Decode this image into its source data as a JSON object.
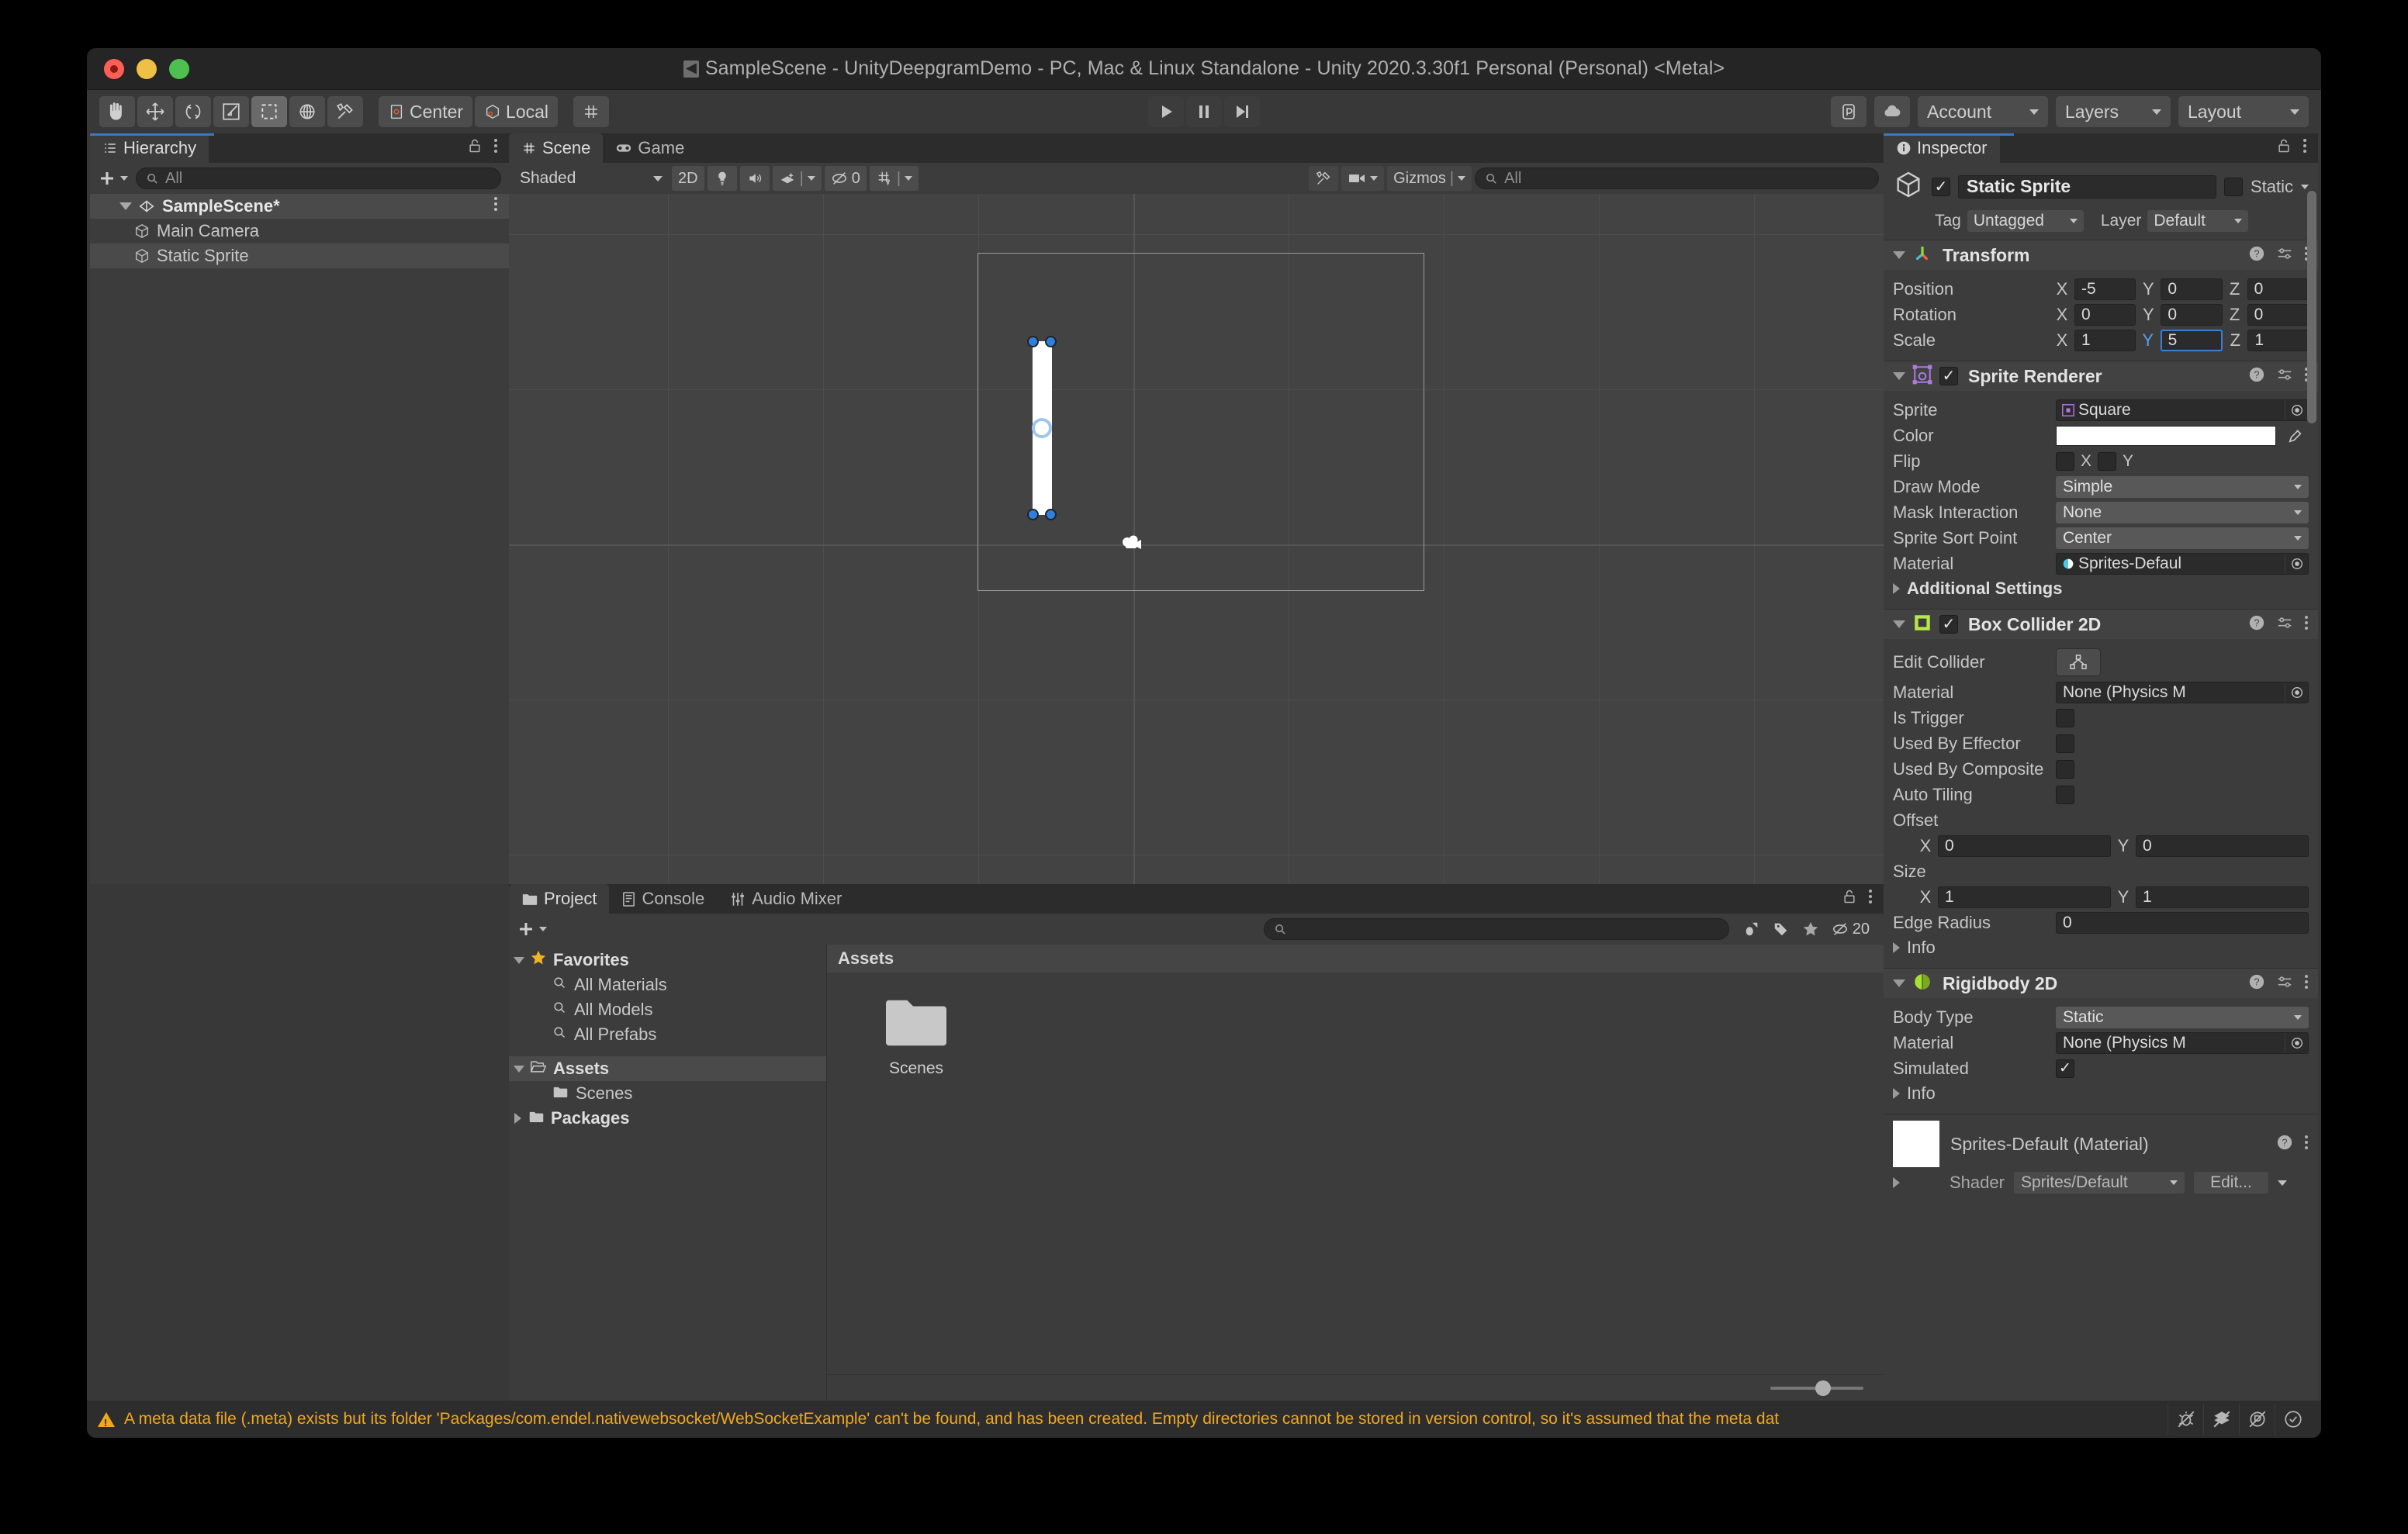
{
  "window": {
    "title": "SampleScene - UnityDeepgramDemo - PC, Mac & Linux Standalone - Unity 2020.3.30f1 Personal (Personal) <Metal>"
  },
  "toolbar": {
    "tools": [
      {
        "name": "hand-tool",
        "icon": "hand",
        "active": false
      },
      {
        "name": "move-tool",
        "icon": "move",
        "active": false
      },
      {
        "name": "rotate-tool",
        "icon": "rotate",
        "active": false
      },
      {
        "name": "scale-tool",
        "icon": "scale",
        "active": false
      },
      {
        "name": "rect-tool",
        "icon": "rect",
        "active": true
      },
      {
        "name": "transform-tool",
        "icon": "transform",
        "active": false
      },
      {
        "name": "custom-tool",
        "icon": "wrench",
        "active": false
      }
    ],
    "pivot_mode": "Center",
    "pivot_rotation": "Local",
    "play": "play",
    "pause": "pause",
    "step": "step",
    "account": "Account",
    "layers": "Layers",
    "layout": "Layout"
  },
  "hierarchy": {
    "tab_label": "Hierarchy",
    "search_placeholder": "All",
    "items": [
      {
        "label": "SampleScene*",
        "depth": 0,
        "type": "scene",
        "selected": true,
        "expanded": true
      },
      {
        "label": "Main Camera",
        "depth": 1,
        "type": "gameobject",
        "selected": false
      },
      {
        "label": "Static Sprite",
        "depth": 1,
        "type": "gameobject",
        "selected": true
      }
    ]
  },
  "scene_view": {
    "tabs": [
      {
        "label": "Scene",
        "active": true,
        "icon": "grid-icon"
      },
      {
        "label": "Game",
        "active": false,
        "icon": "gamepad-icon"
      }
    ],
    "shading_mode": "Shaded",
    "mode_2d": "2D",
    "hidden_count": "0",
    "gizmos_label": "Gizmos",
    "search_placeholder": "All"
  },
  "inspector": {
    "tab_label": "Inspector",
    "object_name": "Static Sprite",
    "enabled": true,
    "static_label": "Static",
    "static_checked": false,
    "tag_label": "Tag",
    "tag_value": "Untagged",
    "layer_label": "Layer",
    "layer_value": "Default",
    "components": [
      {
        "name": "Transform",
        "icon_color": "#f0623c",
        "enabled_toggle": false,
        "rows": [
          {
            "label": "Position",
            "type": "vec3",
            "x": "-5",
            "y": "0",
            "z": "0"
          },
          {
            "label": "Rotation",
            "type": "vec3",
            "x": "0",
            "y": "0",
            "z": "0"
          },
          {
            "label": "Scale",
            "type": "vec3",
            "x": "1",
            "y": "5",
            "z": "1",
            "focus_axis": "Y"
          }
        ]
      },
      {
        "name": "Sprite Renderer",
        "icon_color": "#b07ae0",
        "enabled_toggle": true,
        "rows": [
          {
            "label": "Sprite",
            "type": "object",
            "value": "Square"
          },
          {
            "label": "Color",
            "type": "color",
            "value": "#FFFFFF"
          },
          {
            "label": "Flip",
            "type": "flip",
            "x_label": "X",
            "y_label": "Y",
            "x": false,
            "y": false
          },
          {
            "label": "Draw Mode",
            "type": "enum",
            "value": "Simple"
          },
          {
            "label": "Mask Interaction",
            "type": "enum",
            "value": "None"
          },
          {
            "label": "Sprite Sort Point",
            "type": "enum",
            "value": "Center"
          },
          {
            "label": "Material",
            "type": "object",
            "value": "Sprites-Defaul"
          }
        ],
        "foldout": "Additional Settings"
      },
      {
        "name": "Box Collider 2D",
        "icon_color": "#b6e84a",
        "enabled_toggle": true,
        "rows": [
          {
            "label": "Edit Collider",
            "type": "button"
          },
          {
            "label": "Material",
            "type": "object",
            "value": "None (Physics M"
          },
          {
            "label": "Is Trigger",
            "type": "bool",
            "value": false
          },
          {
            "label": "Used By Effector",
            "type": "bool",
            "value": false
          },
          {
            "label": "Used By Composite",
            "type": "bool",
            "value": false
          },
          {
            "label": "Auto Tiling",
            "type": "bool",
            "value": false
          },
          {
            "label": "Offset",
            "type": "vec2header"
          },
          {
            "label": "",
            "type": "vec2",
            "x": "0",
            "y": "0"
          },
          {
            "label": "Size",
            "type": "vec2header"
          },
          {
            "label": "",
            "type": "vec2",
            "x": "1",
            "y": "1"
          },
          {
            "label": "Edge Radius",
            "type": "num",
            "value": "0"
          }
        ],
        "foldout": "Info"
      },
      {
        "name": "Rigidbody 2D",
        "icon_color": "#a8e030",
        "enabled_toggle": false,
        "rows": [
          {
            "label": "Body Type",
            "type": "enum",
            "value": "Static"
          },
          {
            "label": "Material",
            "type": "object",
            "value": "None (Physics M"
          },
          {
            "label": "Simulated",
            "type": "bool",
            "value": true
          }
        ],
        "foldout": "Info"
      }
    ],
    "material_preview": {
      "title": "Sprites-Default (Material)",
      "shader_label": "Shader",
      "shader_value": "Sprites/Default",
      "edit_label": "Edit..."
    }
  },
  "project": {
    "tabs": [
      {
        "label": "Project",
        "active": true,
        "icon": "folder-icon"
      },
      {
        "label": "Console",
        "active": false,
        "icon": "console-icon"
      },
      {
        "label": "Audio Mixer",
        "active": false,
        "icon": "mixer-icon"
      }
    ],
    "search_placeholder": "",
    "hidden_count": "20",
    "tree": [
      {
        "label": "Favorites",
        "depth": 0,
        "type": "star",
        "bold": true,
        "expanded": true
      },
      {
        "label": "All Materials",
        "depth": 1,
        "type": "search"
      },
      {
        "label": "All Models",
        "depth": 1,
        "type": "search"
      },
      {
        "label": "All Prefabs",
        "depth": 1,
        "type": "search"
      },
      {
        "label": "Assets",
        "depth": 0,
        "type": "folder-open",
        "bold": true,
        "expanded": true,
        "selected": true
      },
      {
        "label": "Scenes",
        "depth": 1,
        "type": "folder"
      },
      {
        "label": "Packages",
        "depth": 0,
        "type": "folder",
        "bold": true,
        "expanded": false
      }
    ],
    "breadcrumb": "Assets",
    "assets": [
      {
        "label": "Scenes",
        "type": "folder"
      }
    ]
  },
  "statusbar": {
    "message": "A meta data file (.meta) exists but its folder 'Packages/com.endel.nativewebsocket/WebSocketExample' can't be found, and has been created. Empty directories cannot be stored in version control, so it's assumed that the meta dat",
    "icons": [
      "debug-off-icon",
      "layers-off-icon",
      "collab-off-icon",
      "check-circle-icon"
    ]
  }
}
